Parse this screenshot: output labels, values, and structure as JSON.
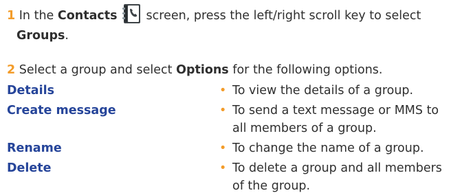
{
  "step1": {
    "number": "1",
    "text_before": "In the",
    "contacts_label": "Contacts",
    "icon": "contacts-phonebook-icon",
    "text_after": "screen, press the left/right scroll key to select",
    "groups_label": "Groups",
    "end_punct": "."
  },
  "step2": {
    "number": "2",
    "text_before": "Select a group and select",
    "options_label": "Options",
    "text_after": "for the following options."
  },
  "options": [
    {
      "term": "Details",
      "bullet": "•",
      "description": "To view the details of a group."
    },
    {
      "term": "Create message",
      "bullet": "•",
      "description": "To send a text message or MMS to all members of a group."
    },
    {
      "term": "Rename",
      "bullet": "•",
      "description": "To change the name of a group."
    },
    {
      "term": "Delete",
      "bullet": "•",
      "description": "To delete a group and all members of the group."
    }
  ],
  "colors": {
    "step_number": "#f39c2a",
    "option_term": "#26459a",
    "bullet": "#f39c2a",
    "body_text": "#2f2f2f"
  }
}
